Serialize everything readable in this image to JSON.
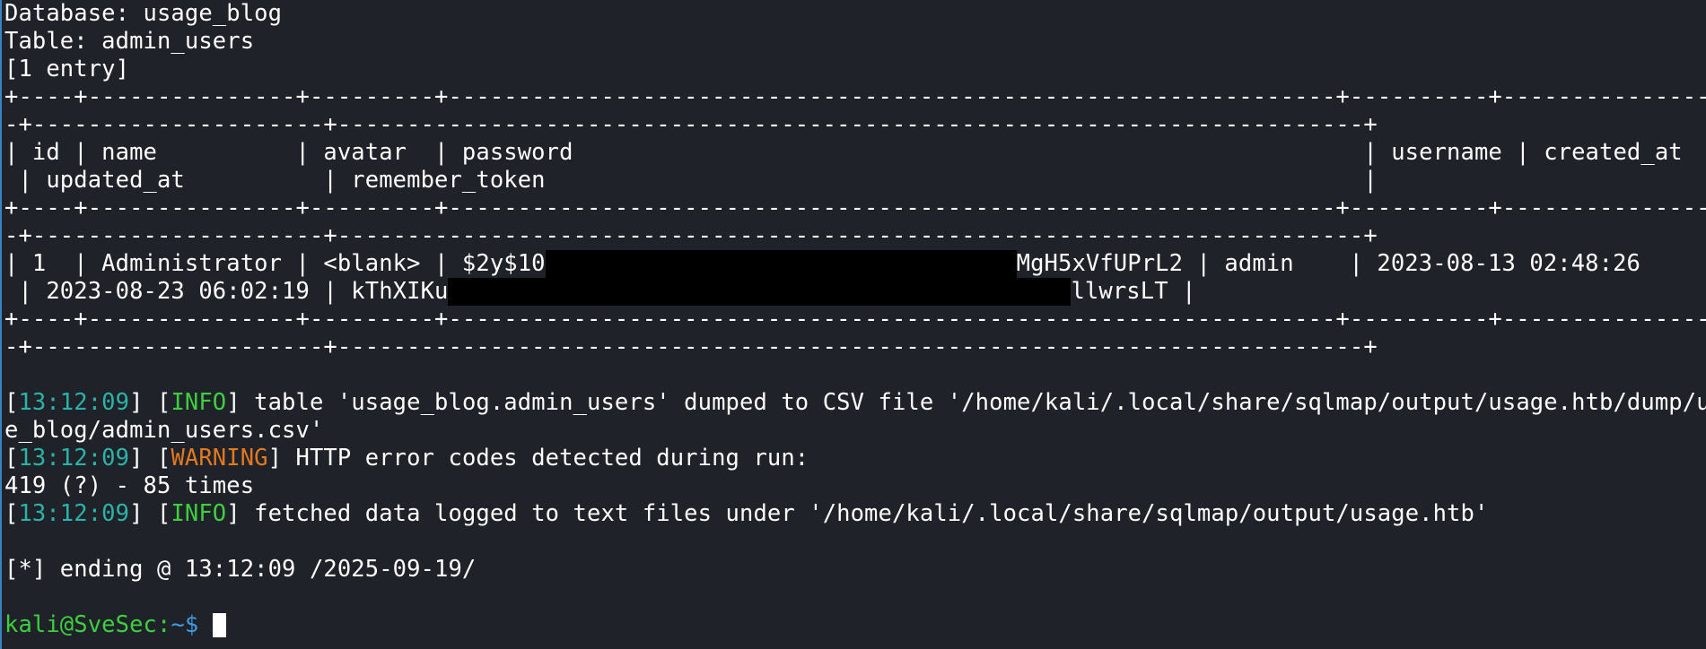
{
  "terminal": {
    "header": {
      "database": "Database: usage_blog",
      "table": "Table: admin_users",
      "entries": "[1 entry]"
    },
    "table_dump": {
      "border_a1": "+----+---------------+---------+----------------------------------------------------------------+----------+---------------------",
      "border_a2": "-+---------------------+--------------------------------------------------------------------------+",
      "columns_line1": "| id | name          | avatar  | password                                                         | username | created_at",
      "columns_line2": " | updated_at          | remember_token                                                           |",
      "row_line1_prefix": "| 1  | Administrator | <blank> | $2y$10",
      "row_line1_suffix": "MgH5xVfUPrL2 | admin    | 2023-08-13 02:48:26",
      "row_line2_prefix": " | 2023-08-23 06:02:19 | kThXIKu",
      "row_line2_suffix": "llwrsLT |"
    },
    "log": [
      {
        "time": "13:12:09",
        "level": "INFO",
        "message": " table 'usage_blog.admin_users' dumped to CSV file '/home/kali/.local/share/sqlmap/output/usage.htb/dump/usag"
      },
      {
        "continuation": "e_blog/admin_users.csv'"
      },
      {
        "time": "13:12:09",
        "level": "WARNING",
        "message": " HTTP error codes detected during run:"
      },
      {
        "continuation": "419 (?) - 85 times"
      },
      {
        "time": "13:12:09",
        "level": "INFO",
        "message": " fetched data logged to text files under '/home/kali/.local/share/sqlmap/output/usage.htb'"
      }
    ],
    "ending": "[*] ending @ 13:12:09 /2025-09-19/",
    "prompt": {
      "user_host": "kali@SveSec:",
      "path": "~$",
      "input": " "
    },
    "colors": {
      "background": "#1f2229",
      "timestamp": "#2bb3a8",
      "info": "#3ecf3e",
      "warning": "#e0791f",
      "prompt_user": "#3ecf3e",
      "prompt_path": "#3b9de0"
    }
  }
}
